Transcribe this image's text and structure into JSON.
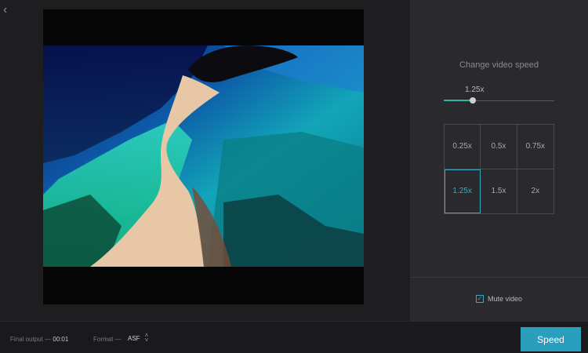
{
  "header": {
    "back_icon": "chevron-left-icon"
  },
  "video": {
    "description_icon": "video-preview"
  },
  "speed_panel": {
    "title": "Change video speed",
    "current_speed": "1.25x",
    "slider_fraction": 0.26,
    "options": [
      {
        "label": "0.25x",
        "selected": false
      },
      {
        "label": "0.5x",
        "selected": false
      },
      {
        "label": "0.75x",
        "selected": false
      },
      {
        "label": "1.25x",
        "selected": true
      },
      {
        "label": "1.5x",
        "selected": false
      },
      {
        "label": "2x",
        "selected": false
      }
    ],
    "mute_label": "Mute video",
    "mute_checked": true
  },
  "footer": {
    "final_output_label": "Final output —",
    "final_output_value": "00:01",
    "format_label": "Format —",
    "format_value": "ASF",
    "speed_button": "Speed"
  },
  "colors": {
    "accent": "#2a9fbd",
    "slider": "#2eb4a2",
    "selected": "#3aa7c4"
  }
}
